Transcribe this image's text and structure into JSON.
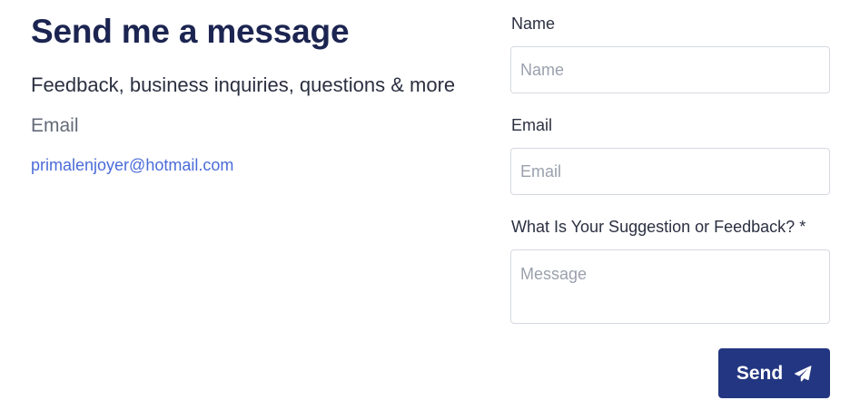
{
  "contact": {
    "title": "Send me a message",
    "subtitle": "Feedback, business inquiries, questions & more",
    "email_heading": "Email",
    "email_address": "primalenjoyer@hotmail.com"
  },
  "form": {
    "name_label": "Name",
    "name_placeholder": "Name",
    "email_label": "Email",
    "email_placeholder": "Email",
    "message_label": "What Is Your Suggestion or Feedback? *",
    "message_placeholder": "Message",
    "send_label": "Send",
    "send_icon": "paper-plane-icon"
  },
  "colors": {
    "title": "#1c2551",
    "link": "#4a6cd8",
    "button_bg": "#233681",
    "field_border": "#d5d9e0"
  }
}
